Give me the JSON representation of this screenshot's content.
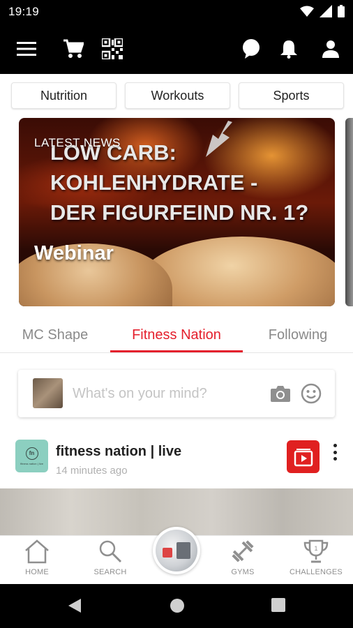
{
  "status_bar": {
    "time": "19:19"
  },
  "app_bar": {
    "icons": [
      "menu-icon",
      "cart-icon",
      "qr-code-icon",
      "chat-bubble-icon",
      "bell-icon",
      "account-icon"
    ]
  },
  "chips": [
    "Nutrition",
    "Workouts",
    "Sports"
  ],
  "banner": {
    "label": "LATEST NEWS",
    "headline": "LOW CARB:\nKOHLENHYDRATE -\nDER FIGURFEIND NR. 1?",
    "tag": "Webinar"
  },
  "feed_tabs": [
    {
      "label": "MC Shape",
      "active": false
    },
    {
      "label": "Fitness Nation",
      "active": true
    },
    {
      "label": "Following",
      "active": false
    }
  ],
  "composer": {
    "placeholder": "What's on your mind?"
  },
  "post": {
    "author": "fitness nation | live",
    "time": "14 minutes ago",
    "avatar_initials": "fn",
    "avatar_caption": "fitness nation | live"
  },
  "bottom_nav": [
    {
      "label": "HOME",
      "icon": "home-icon"
    },
    {
      "label": "SEARCH",
      "icon": "search-icon"
    },
    {
      "label": "GYMS",
      "icon": "dumbbell-icon"
    },
    {
      "label": "CHALLENGES",
      "icon": "trophy-icon"
    }
  ],
  "colors": {
    "accent": "#e4202d",
    "app_bar": "#000000",
    "youtube_red": "#e02020"
  }
}
